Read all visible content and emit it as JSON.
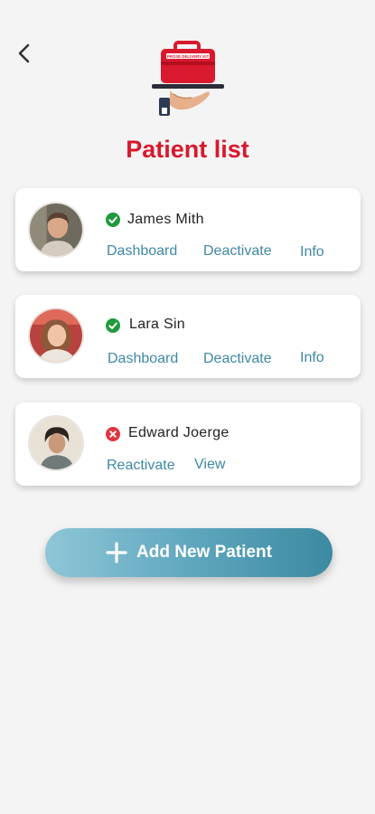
{
  "header": {
    "back_icon": "chevron-left-icon",
    "logo_text": "PROSE DELIVERY KIT",
    "title": "Patient list"
  },
  "patients": [
    {
      "name": "James  Mith",
      "status": "active",
      "status_color": "#1e9a3b",
      "actions": [
        "Dashboard",
        "Deactivate",
        "Info"
      ]
    },
    {
      "name": "Lara  Sin",
      "status": "active",
      "status_color": "#1e9a3b",
      "actions": [
        "Dashboard",
        "Deactivate",
        "Info"
      ]
    },
    {
      "name": "Edward Joerge",
      "status": "inactive",
      "status_color": "#e0353f",
      "actions": [
        "Reactivate",
        "View"
      ]
    }
  ],
  "add_button": {
    "label": "Add New Patient",
    "icon": "plus-icon"
  },
  "colors": {
    "accent_red": "#d8192e",
    "link": "#3e88a6",
    "button_gradient_start": "#8ec6d7",
    "button_gradient_end": "#3c8aa1"
  }
}
